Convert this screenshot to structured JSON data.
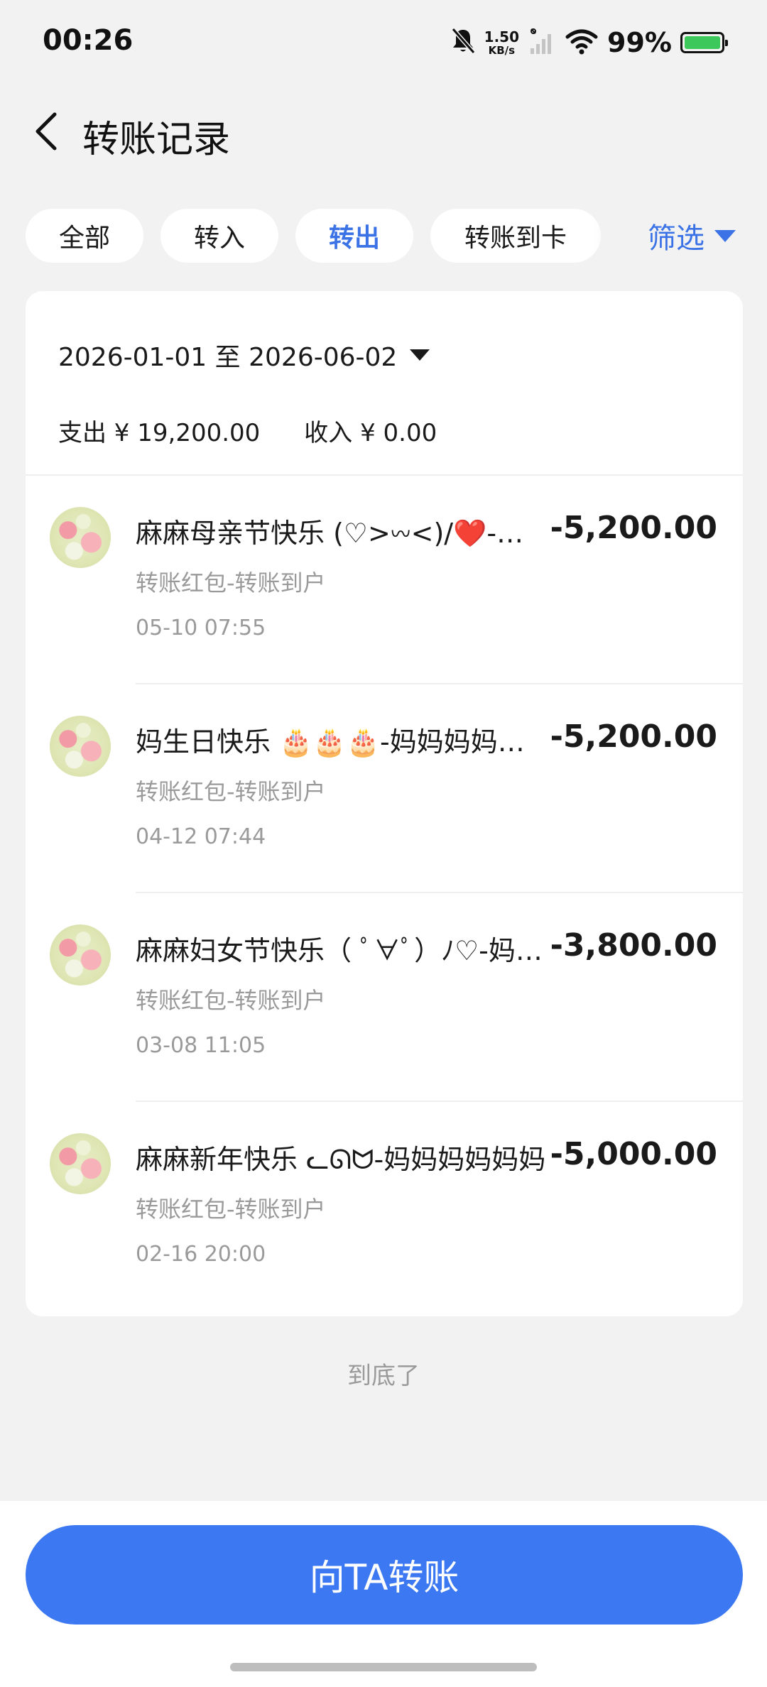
{
  "status_bar": {
    "time": "00:26",
    "net_speed_value": "1.50",
    "net_speed_unit": "KB/s",
    "battery_percent": "99%",
    "battery_level": 0.99,
    "icons": [
      "bell-muted-icon",
      "signal-icon",
      "wifi-icon",
      "battery-icon"
    ]
  },
  "header": {
    "title": "转账记录",
    "back_icon": "chevron-left-icon"
  },
  "tabs": [
    {
      "label": "全部",
      "active": false
    },
    {
      "label": "转入",
      "active": false
    },
    {
      "label": "转出",
      "active": true
    },
    {
      "label": "转账到卡",
      "active": false
    }
  ],
  "filter": {
    "label": "筛选",
    "icon": "triangle-down-icon"
  },
  "summary": {
    "date_range": "2026-01-01 至 2026-06-02",
    "expense": "支出 ¥ 19,200.00",
    "income": "收入 ¥ 0.00"
  },
  "transactions": [
    {
      "title": "麻麻母亲节快乐 (♡>𖥦<)/❤️-妈妈妈妈",
      "amount": "-5,200.00",
      "subtitle": "转账红包-转账到户",
      "time": "05-10 07:55"
    },
    {
      "title": "妈生日快乐 🎂🎂🎂-妈妈妈妈妈妈",
      "amount": "-5,200.00",
      "subtitle": "转账红包-转账到户",
      "time": "04-12 07:44"
    },
    {
      "title": "麻麻妇女节快乐（ ﾟ∀ﾟ）ﾉ♡-妈妈妈妈",
      "amount": "-3,800.00",
      "subtitle": "转账红包-转账到户",
      "time": "03-08 11:05"
    },
    {
      "title": "麻麻新年快乐 ᓚᘏᗢ-妈妈妈妈妈妈",
      "amount": "-5,000.00",
      "subtitle": "转账红包-转账到户",
      "time": "02-16 20:00"
    }
  ],
  "end_text": "到底了",
  "bottom": {
    "button_label": "向TA转账"
  },
  "colors": {
    "accent": "#3b73e6",
    "button": "#3b78f2",
    "background": "#f2f2f2",
    "secondary_text": "#9a9a9a"
  }
}
